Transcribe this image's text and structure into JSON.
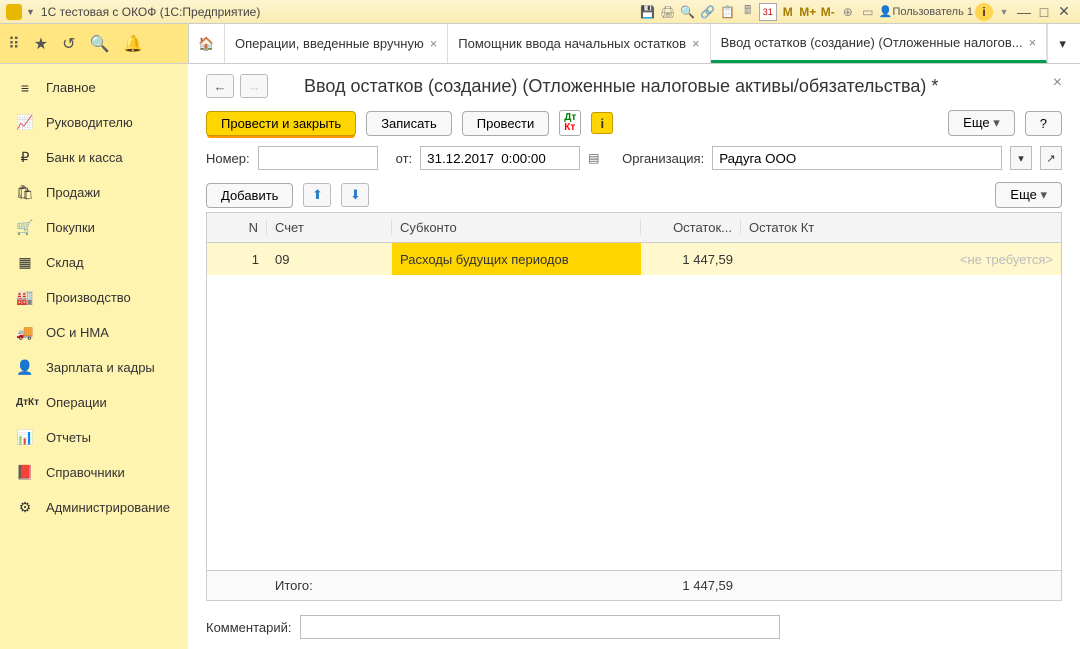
{
  "titlebar": {
    "title": "1С тестовая с ОКОФ  (1С:Предприятие)",
    "user": "Пользователь 1"
  },
  "tabs": {
    "t1": "Операции, введенные вручную",
    "t2": "Помощник ввода начальных остатков",
    "t3": "Ввод остатков (создание) (Отложенные налогов..."
  },
  "sidebar": {
    "items": [
      {
        "label": "Главное",
        "icon": "≡"
      },
      {
        "label": "Руководителю",
        "icon": "📈"
      },
      {
        "label": "Банк и касса",
        "icon": "₽"
      },
      {
        "label": "Продажи",
        "icon": "🛍"
      },
      {
        "label": "Покупки",
        "icon": "🛒"
      },
      {
        "label": "Склад",
        "icon": "▦"
      },
      {
        "label": "Производство",
        "icon": "🏭"
      },
      {
        "label": "ОС и НМА",
        "icon": "🚚"
      },
      {
        "label": "Зарплата и кадры",
        "icon": "👤"
      },
      {
        "label": "Операции",
        "icon": "ДтКт"
      },
      {
        "label": "Отчеты",
        "icon": "📊"
      },
      {
        "label": "Справочники",
        "icon": "📕"
      },
      {
        "label": "Администрирование",
        "icon": "⚙"
      }
    ]
  },
  "form": {
    "title": "Ввод остатков (создание) (Отложенные налоговые активы/обязательства) *",
    "btn_post_close": "Провести и закрыть",
    "btn_save": "Записать",
    "btn_post": "Провести",
    "btn_more": "Еще",
    "btn_help": "?",
    "number_label": "Номер:",
    "number_value": "",
    "date_label": "от:",
    "date_value": "31.12.2017  0:00:00",
    "org_label": "Организация:",
    "org_value": "Радуга ООО",
    "btn_add": "Добавить",
    "btn_more2": "Еще",
    "comment_label": "Комментарий:",
    "comment_value": ""
  },
  "grid": {
    "head": {
      "n": "N",
      "acc": "Счет",
      "sub": "Субконто",
      "dt": "Остаток...",
      "kt": "Остаток Кт"
    },
    "rows": [
      {
        "n": "1",
        "acc": "09",
        "sub": "Расходы будущих периодов",
        "dt": "1 447,59",
        "kt": "<не требуется>"
      }
    ],
    "foot": {
      "label": "Итого:",
      "dt": "1 447,59"
    }
  }
}
